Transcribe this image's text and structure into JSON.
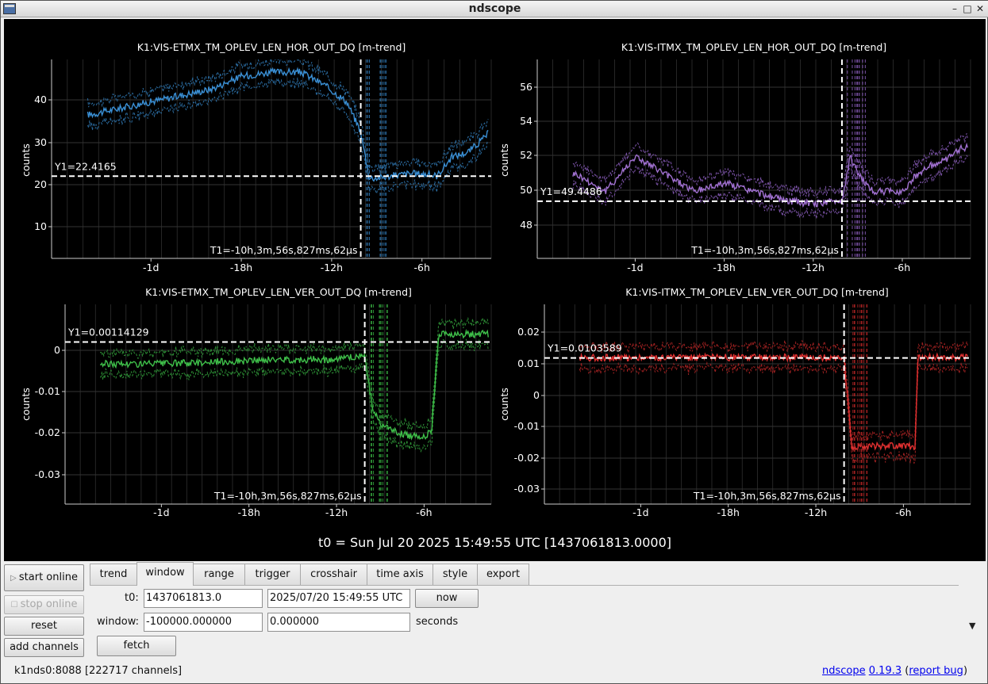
{
  "window": {
    "title": "ndscope"
  },
  "plots": [
    {
      "title": "K1:VIS-ETMX_TM_OPLEV_LEN_HOR_OUT_DQ [m-trend]",
      "ylabel": "counts",
      "yticks": [
        "40",
        "30",
        "20",
        "10"
      ],
      "y1_label": "Y1=22.4165",
      "t1_label": "T1=-10h,3m,56s,827ms,62µs",
      "xticks": [
        "-1d",
        "-18h",
        "-12h",
        "-6h"
      ],
      "color": "#3a8fd4",
      "fill_color": "#2a6a9e"
    },
    {
      "title": "K1:VIS-ITMX_TM_OPLEV_LEN_HOR_OUT_DQ [m-trend]",
      "ylabel": "counts",
      "yticks": [
        "56",
        "54",
        "52",
        "50",
        "48"
      ],
      "y1_label": "Y1=49.4486",
      "t1_label": "T1=-10h,3m,56s,827ms,62µs",
      "xticks": [
        "-1d",
        "-18h",
        "-12h",
        "-6h"
      ],
      "color": "#a070d0",
      "fill_color": "#7a52a6"
    },
    {
      "title": "K1:VIS-ETMX_TM_OPLEV_LEN_VER_OUT_DQ [m-trend]",
      "ylabel": "counts",
      "yticks": [
        "0",
        "-0.01",
        "-0.02",
        "-0.03"
      ],
      "y1_label": "Y1=0.00114129",
      "t1_label": "T1=-10h,3m,56s,827ms,62µs",
      "xticks": [
        "-1d",
        "-18h",
        "-12h",
        "-6h"
      ],
      "color": "#3fc04a",
      "fill_color": "#2c8c34"
    },
    {
      "title": "K1:VIS-ITMX_TM_OPLEV_LEN_VER_OUT_DQ [m-trend]",
      "ylabel": "counts",
      "yticks": [
        "0.02",
        "0.01",
        "0",
        "-0.01",
        "-0.02",
        "-0.03"
      ],
      "y1_label": "Y1=0.0103589",
      "t1_label": "T1=-10h,3m,56s,827ms,62µs",
      "xticks": [
        "-1d",
        "-18h",
        "-12h",
        "-6h"
      ],
      "color": "#e03030",
      "fill_color": "#9c2020"
    }
  ],
  "t0_banner": "t0 = Sun Jul 20 2025 15:49:55 UTC [1437061813.0000]",
  "side_buttons": {
    "start_online": "start online",
    "stop_online": "stop online",
    "reset": "reset",
    "add_channels": "add channels"
  },
  "tabs": [
    "trend",
    "window",
    "range",
    "trigger",
    "crosshair",
    "time axis",
    "style",
    "export"
  ],
  "active_tab": "window",
  "window_tab": {
    "t0_label": "t0:",
    "t0_gps": "1437061813.0",
    "t0_utc": "2025/07/20 15:49:55 UTC",
    "now_label": "now",
    "window_label": "window:",
    "window_start": "-100000.000000",
    "window_end": "0.000000",
    "seconds_label": "seconds",
    "fetch_label": "fetch"
  },
  "status": {
    "server": "k1nds0:8088",
    "channels": "[222717 channels]",
    "app_name": "ndscope",
    "version": "0.19.3",
    "report_bug": "report bug"
  },
  "chart_data": [
    {
      "type": "line",
      "title": "K1:VIS-ETMX_TM_OPLEV_LEN_HOR_OUT_DQ [m-trend]",
      "ylabel": "counts",
      "x_unit": "hours relative to t0",
      "x": [
        -28,
        -24,
        -20,
        -18,
        -16,
        -14,
        -12.5,
        -11,
        -10.07,
        -9.5,
        -9,
        -8,
        -7,
        -6,
        -5,
        -4,
        -3,
        -2,
        -1.5
      ],
      "series": [
        {
          "values": [
            37,
            40,
            43,
            46,
            47,
            47,
            44,
            40,
            33,
            22,
            22,
            22.5,
            23,
            23,
            22.5,
            27,
            28,
            31,
            33
          ]
        }
      ],
      "ylim": [
        3,
        50
      ],
      "cursors": {
        "Y1": 22.4165,
        "T1_hours": -10.066
      }
    },
    {
      "type": "line",
      "title": "K1:VIS-ITMX_TM_OPLEV_LEN_HOR_OUT_DQ [m-trend]",
      "ylabel": "counts",
      "x_unit": "hours relative to t0",
      "x": [
        -28,
        -26,
        -24,
        -22,
        -20,
        -18,
        -16,
        -14,
        -12,
        -10.07,
        -9.5,
        -9,
        -8,
        -7,
        -6,
        -5,
        -4,
        -3,
        -2
      ],
      "series": [
        {
          "values": [
            51,
            50,
            52,
            51,
            50,
            50.5,
            50,
            49.5,
            49.3,
            49.5,
            52,
            51,
            50,
            50,
            50,
            51,
            51.5,
            51.8,
            52.5
          ]
        }
      ],
      "ylim": [
        46.2,
        57.5
      ],
      "cursors": {
        "Y1": 49.4486,
        "T1_hours": -10.066
      }
    },
    {
      "type": "line",
      "title": "K1:VIS-ETMX_TM_OPLEV_LEN_VER_OUT_DQ [m-trend]",
      "ylabel": "counts",
      "x_unit": "hours relative to t0",
      "x": [
        -28,
        -24,
        -20,
        -16,
        -12,
        -10.07,
        -9.5,
        -9,
        -8,
        -7,
        -6,
        -5.5,
        -5,
        -4,
        -3,
        -2,
        -1.5
      ],
      "series": [
        {
          "values": [
            -0.004,
            -0.004,
            -0.0035,
            -0.003,
            -0.003,
            -0.002,
            -0.015,
            -0.018,
            -0.02,
            -0.021,
            -0.021,
            -0.02,
            0.003,
            0.003,
            0.003,
            0.003,
            0.003
          ]
        }
      ],
      "ylim": [
        -0.037,
        0.01
      ],
      "cursors": {
        "Y1": 0.00114129,
        "T1_hours": -10.066
      }
    },
    {
      "type": "line",
      "title": "K1:VIS-ITMX_TM_OPLEV_LEN_VER_OUT_DQ [m-trend]",
      "ylabel": "counts",
      "x_unit": "hours relative to t0",
      "x": [
        -28,
        -24,
        -20,
        -16,
        -12,
        -10.07,
        -9.5,
        -9,
        -8,
        -7,
        -6,
        -5.2,
        -5,
        -4,
        -3,
        -2,
        -1
      ],
      "series": [
        {
          "values": [
            0.0105,
            0.0105,
            0.0105,
            0.0105,
            0.0105,
            0.0105,
            -0.018,
            -0.017,
            -0.017,
            -0.017,
            -0.017,
            -0.017,
            0.0105,
            0.0105,
            0.0105,
            0.0105,
            0.0105
          ]
        }
      ],
      "ylim": [
        -0.035,
        0.027
      ],
      "cursors": {
        "Y1": 0.0103589,
        "T1_hours": -10.066
      }
    }
  ]
}
